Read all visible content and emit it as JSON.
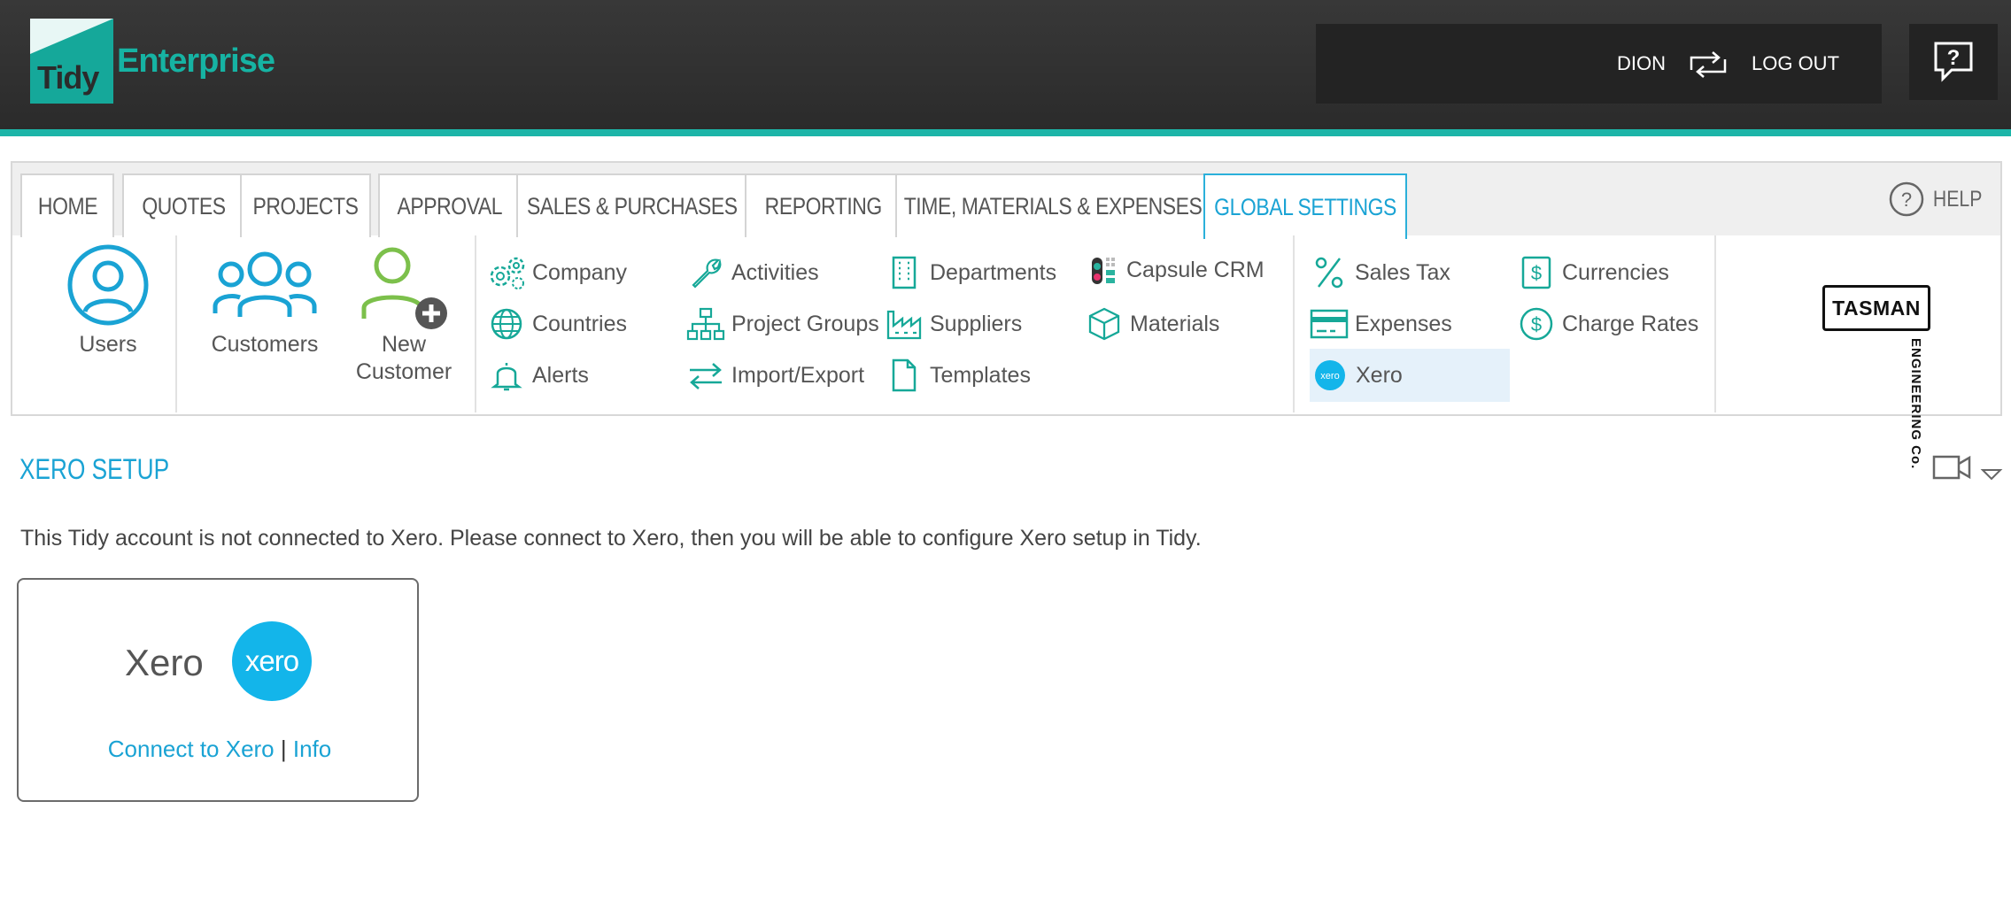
{
  "header": {
    "logo_word1": "Tidy",
    "logo_word2": "Enterprise",
    "user_name": "DION",
    "logout_label": "LOG OUT",
    "switch_icon": "swap-arrows-icon",
    "help_icon": "help-speech-bubble-icon"
  },
  "tabs": [
    {
      "label": "HOME",
      "active": false
    },
    {
      "label": "QUOTES",
      "active": false
    },
    {
      "label": "PROJECTS",
      "active": false
    },
    {
      "label": "APPROVAL",
      "active": false
    },
    {
      "label": "SALES & PURCHASES",
      "active": false
    },
    {
      "label": "REPORTING",
      "active": false
    },
    {
      "label": "TIME, MATERIALS & EXPENSES",
      "active": false
    },
    {
      "label": "GLOBAL SETTINGS",
      "active": true
    }
  ],
  "help_link": "HELP",
  "big_items": {
    "users": "Users",
    "customers": "Customers",
    "new_customer_l1": "New",
    "new_customer_l2": "Customer"
  },
  "menu": {
    "company": "Company",
    "countries": "Countries",
    "alerts": "Alerts",
    "activities": "Activities",
    "project_groups": "Project Groups",
    "import_export": "Import/Export",
    "departments": "Departments",
    "suppliers": "Suppliers",
    "templates": "Templates",
    "capsule_crm": "Capsule CRM",
    "materials": "Materials",
    "sales_tax": "Sales Tax",
    "expenses": "Expenses",
    "xero": "Xero",
    "currencies": "Currencies",
    "charge_rates": "Charge Rates"
  },
  "brand_logo": {
    "name": "TASMAN",
    "subtitle": "ENGINEERING Co."
  },
  "page": {
    "title": "XERO SETUP",
    "message": "This Tidy account is not connected to Xero. Please connect to Xero, then you will be able to configure Xero setup in Tidy.",
    "card": {
      "name": "Xero",
      "logo_text": "xero",
      "connect_link": "Connect to Xero",
      "separator": "|",
      "info_link": "Info"
    }
  },
  "colors": {
    "teal": "#1cb5a8",
    "accent_blue": "#1aa3d4",
    "xero_blue": "#13b5ea",
    "header_dark": "#2f2f2f",
    "green_user": "#7cc04b"
  }
}
